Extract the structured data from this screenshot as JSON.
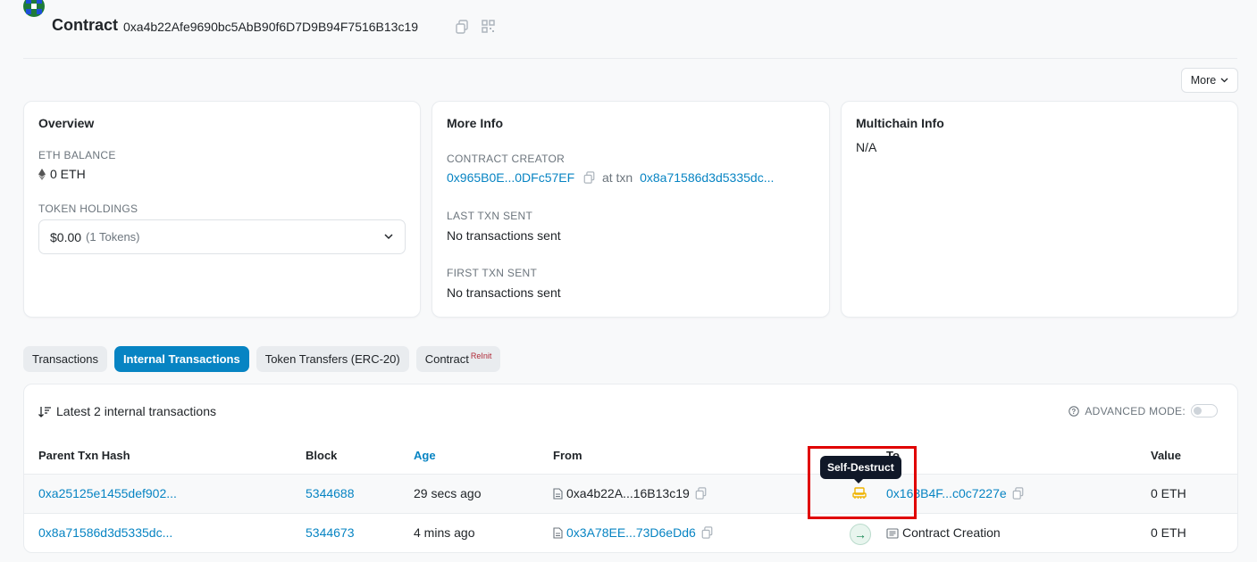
{
  "header": {
    "title": "Contract",
    "address": "0xa4b22Afe9690bc5AbB90f6D7D9B94F7516B13c19"
  },
  "more_button": {
    "label": "More"
  },
  "overview": {
    "title": "Overview",
    "eth_balance_label": "ETH BALANCE",
    "eth_balance_value": "0 ETH",
    "token_holdings_label": "TOKEN HOLDINGS",
    "token_value": "$0.00",
    "token_count": "(1 Tokens)"
  },
  "more_info": {
    "title": "More Info",
    "creator_label": "CONTRACT CREATOR",
    "creator_address": "0x965B0E...0DFc57EF",
    "at_txn_text": "at txn",
    "creator_txn": "0x8a71586d3d5335dc...",
    "last_txn_label": "LAST TXN SENT",
    "last_txn_value": "No transactions sent",
    "first_txn_label": "FIRST TXN SENT",
    "first_txn_value": "No transactions sent"
  },
  "multichain": {
    "title": "Multichain Info",
    "value": "N/A"
  },
  "tabs": [
    {
      "label": "Transactions"
    },
    {
      "label": "Internal Transactions",
      "active": true
    },
    {
      "label": "Token Transfers (ERC-20)"
    },
    {
      "label": "Contract",
      "badge": "ReInit"
    }
  ],
  "panel": {
    "summary": "Latest 2 internal transactions",
    "advanced_mode_label": "ADVANCED MODE:"
  },
  "table": {
    "headers": {
      "parent_txn_hash": "Parent Txn Hash",
      "block": "Block",
      "age": "Age",
      "from": "From",
      "to": "To",
      "value": "Value"
    },
    "rows": [
      {
        "parent_txn_hash": "0xa25125e1455def902...",
        "block": "5344688",
        "age": "29 secs ago",
        "from": "0xa4b22A...16B13c19",
        "to": "0x163B4F...c0c7227e",
        "value": "0 ETH",
        "type_icon": "self-destruct-icon"
      },
      {
        "parent_txn_hash": "0x8a71586d3d5335dc...",
        "block": "5344673",
        "age": "4 mins ago",
        "from": "0x3A78EE...73D6eDd6",
        "to": "Contract Creation",
        "value": "0 ETH",
        "type_icon": "arrow-right-icon"
      }
    ]
  },
  "tooltip": {
    "text": "Self-Destruct"
  },
  "colors": {
    "link": "#0784c3",
    "active_tab": "#0784c3",
    "highlight_box": "#e00000",
    "self_destruct_icon": "#f0b400"
  }
}
